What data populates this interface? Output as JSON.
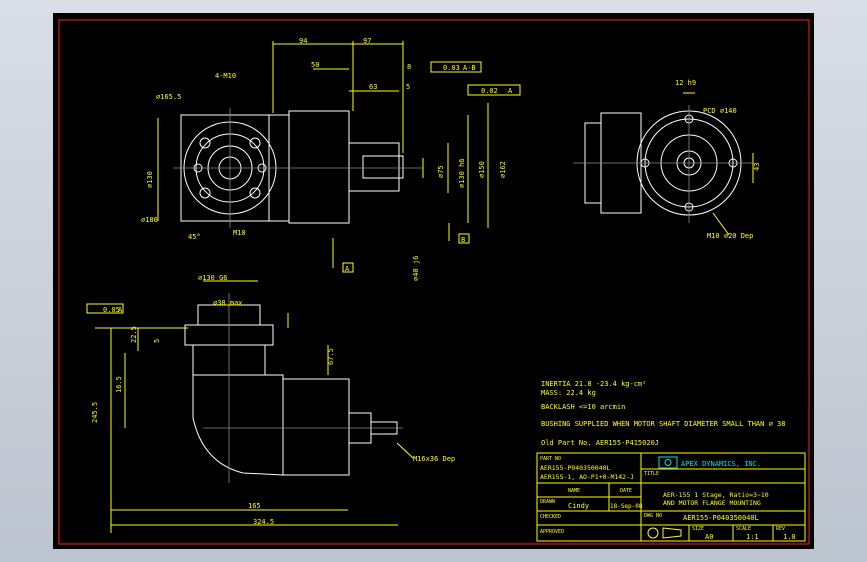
{
  "colors": {
    "background": "#000000",
    "border": "#ff2020",
    "dimension": "#ffff00",
    "outline": "#ffffff",
    "logo": "#00e0e0"
  },
  "top_view": {
    "dims": [
      "94",
      "97",
      "50",
      "63",
      "5",
      "8",
      "0.03",
      "A-B",
      "0.02",
      "A"
    ],
    "labels": [
      "4-M10",
      "⌀165.5",
      "⌀186",
      "45°",
      "⌀75",
      "⌀130 h6",
      "⌀150",
      "⌀162",
      "⌀130",
      "⌀40 j6",
      "A",
      "B",
      "M10"
    ]
  },
  "side_view": {
    "labels": [
      "12 h9",
      "PCD ⌀140",
      "43",
      "M10 ⌀20 Dep"
    ]
  },
  "front_view": {
    "labels": [
      "⌀130 G6",
      "⌀38 max",
      "0.05",
      "A",
      "22.5",
      "5",
      "67.5",
      "245.5",
      "16.5",
      "165",
      "324.5",
      "M16x36 Dep"
    ]
  },
  "notes": {
    "inertia": "INERTIA  21.8 -23.4 kg-cm²",
    "mass": "MASS: 22.4 kg",
    "backlash": "BACKLASH <=10 arcmin",
    "bushing": "BUSHING SUPPLIED WHEN MOTOR SHAFT DIAMETER SMALL THAN ⌀ 38",
    "old_part": "Old Part No. AER155-P415020J"
  },
  "title_block": {
    "part_no_label": "PART NO",
    "part_no_1": "AER155-P040350040L",
    "part_no_2": "AER155-1, AO-P1+0-M142-J",
    "company": "APEX DYNAMICS, INC.",
    "title_label": "TITLE",
    "title_1": "AER-155 1 Stage, Ratio=3~10",
    "title_2": "AND MOTOR FLANGE MOUNTING",
    "name_label": "NAME",
    "date_label": "DATE",
    "drawn_label": "DRAWN",
    "drawn_by": "Cindy",
    "drawn_date": "18-Sep-08",
    "dwg_label": "DWG NO",
    "dwg_no": "AER155-P040350040L",
    "checked_label": "CHECKED",
    "approved_label": "APPROVED",
    "size_label": "SIZE",
    "size": "A0",
    "scale_label": "SCALE",
    "scale": "1:1",
    "rev_label": "REV",
    "rev": "1.0"
  }
}
